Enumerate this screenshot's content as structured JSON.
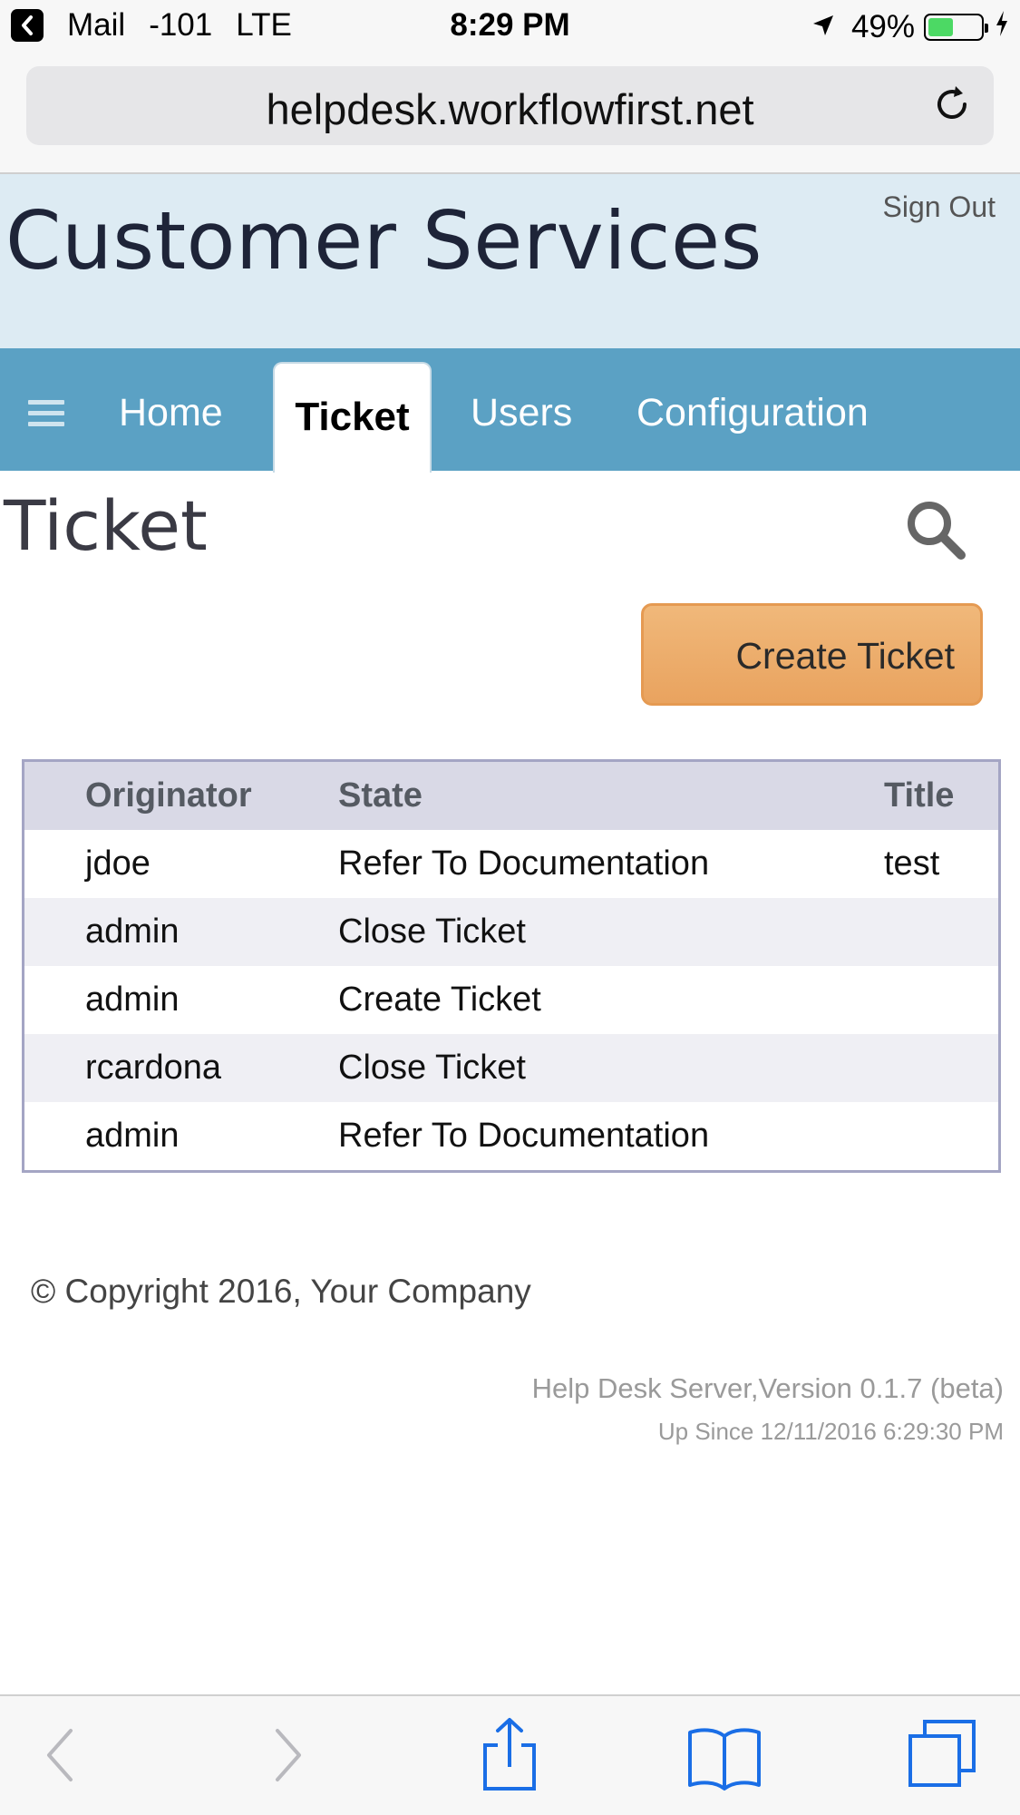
{
  "status_bar": {
    "back_app": "Mail",
    "signal": "-101",
    "network": "LTE",
    "time": "8:29 PM",
    "battery": "49%",
    "battery_level": 0.49
  },
  "browser": {
    "url": "helpdesk.workflowfirst.net"
  },
  "header": {
    "title": "Customer Services",
    "sign_out": "Sign Out"
  },
  "nav": {
    "items": [
      {
        "label": "Home"
      },
      {
        "label": "Ticket",
        "active": true
      },
      {
        "label": "Users"
      },
      {
        "label": "Configuration"
      }
    ]
  },
  "page": {
    "title": "Ticket",
    "create_button": "Create Ticket"
  },
  "table": {
    "columns": [
      "Originator",
      "State",
      "Title"
    ],
    "rows": [
      {
        "originator": "jdoe",
        "state": "Refer To Documentation",
        "title": "test"
      },
      {
        "originator": "admin",
        "state": "Close Ticket",
        "title": ""
      },
      {
        "originator": "admin",
        "state": "Create Ticket",
        "title": ""
      },
      {
        "originator": "rcardona",
        "state": "Close Ticket",
        "title": ""
      },
      {
        "originator": "admin",
        "state": "Refer To Documentation",
        "title": ""
      }
    ]
  },
  "footer": {
    "copyright": "© Copyright 2016, Your Company",
    "version": "Help Desk Server,Version 0.1.7 (beta)",
    "up_since": "Up Since 12/11/2016 6:29:30 PM"
  },
  "colors": {
    "nav_bg": "#5ba1c4",
    "header_bg": "#ddebf3",
    "button_orange": "#e9a35f",
    "ios_blue": "#1a6ee6"
  },
  "icons": {
    "status_back": "chevron-left-icon",
    "location": "location-arrow-icon",
    "charging": "bolt-icon",
    "reload": "reload-icon",
    "menu": "hamburger-icon",
    "search": "search-icon",
    "toolbar": [
      "back-arrow-icon",
      "forward-arrow-icon",
      "share-icon",
      "bookmarks-icon",
      "tabs-icon"
    ]
  }
}
